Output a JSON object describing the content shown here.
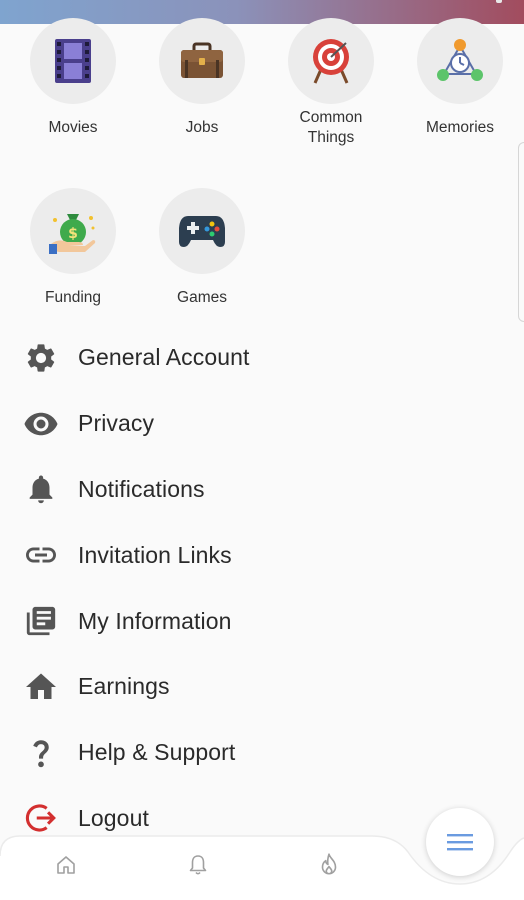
{
  "categories": [
    {
      "label": "Movies",
      "icon": "film-icon"
    },
    {
      "label": "Jobs",
      "icon": "briefcase-icon"
    },
    {
      "label": "Common Things",
      "icon": "target-icon"
    },
    {
      "label": "Memories",
      "icon": "network-icon"
    },
    {
      "label": "Funding",
      "icon": "money-bag-icon"
    },
    {
      "label": "Games",
      "icon": "gamepad-icon"
    }
  ],
  "menu": [
    {
      "label": "General Account",
      "icon": "gear-icon"
    },
    {
      "label": "Privacy",
      "icon": "eye-icon"
    },
    {
      "label": "Notifications",
      "icon": "bell-icon"
    },
    {
      "label": "Invitation Links",
      "icon": "link-icon"
    },
    {
      "label": "My Information",
      "icon": "document-list-icon"
    },
    {
      "label": "Earnings",
      "icon": "home-icon"
    },
    {
      "label": "Help & Support",
      "icon": "question-icon"
    },
    {
      "label": "Logout",
      "icon": "logout-icon"
    }
  ],
  "bottom_nav": [
    {
      "icon": "home-icon"
    },
    {
      "icon": "bell-icon"
    },
    {
      "icon": "flame-icon"
    }
  ],
  "fab": {
    "icon": "menu-icon"
  },
  "colors": {
    "icon_grey": "#555555",
    "logout_red": "#d32f2f",
    "fab_blue": "#6a9be0"
  }
}
